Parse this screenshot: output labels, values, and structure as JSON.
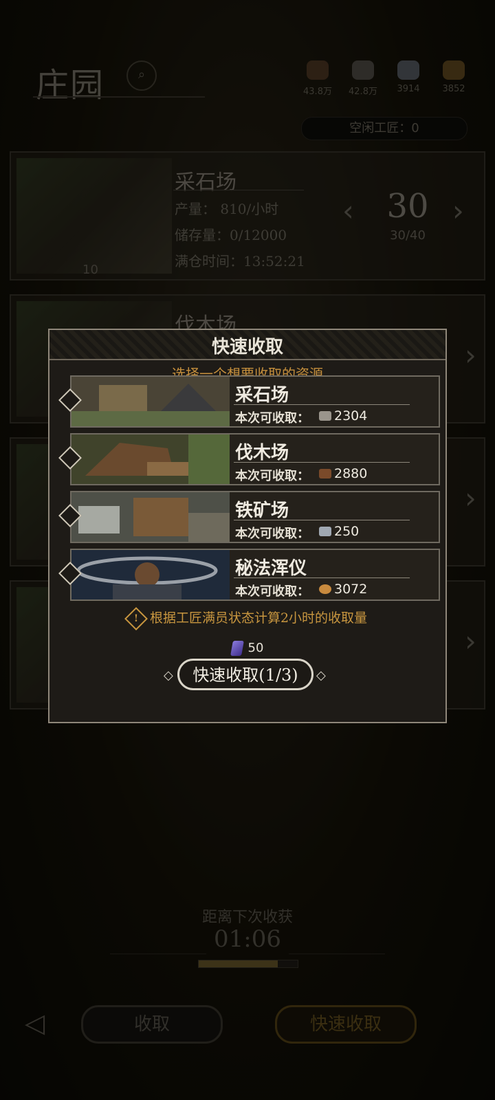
{
  "header": {
    "title": "庄园",
    "resources": [
      {
        "icon": "wood-resource-icon",
        "value": "43.8万",
        "color": "#6b4a30"
      },
      {
        "icon": "stone-resource-icon",
        "value": "42.8万",
        "color": "#6e6a64"
      },
      {
        "icon": "iron-resource-icon",
        "value": "3914",
        "color": "#7a8492"
      },
      {
        "icon": "gold-resource-icon",
        "value": "3852",
        "color": "#8a6a2c"
      }
    ],
    "idle_workers": "空闲工匠：0"
  },
  "cards": [
    {
      "title": "采石场",
      "production": "产量：  810/小时",
      "storage": "储存量：0/12000",
      "full_time": "满仓时间：13:52:21",
      "level": "10",
      "workers": "30",
      "workers_cap": "30/40"
    },
    {
      "title": "伐木场"
    }
  ],
  "modal": {
    "title": "快速收取",
    "subtitle": "选择一个想要收取的资源",
    "collect_label": "本次可收取：",
    "options": [
      {
        "name": "采石场",
        "amount": "2304",
        "icon": "stone-icon",
        "color": "#9a958c"
      },
      {
        "name": "伐木场",
        "amount": "2880",
        "icon": "wood-icon",
        "color": "#7a4a2a"
      },
      {
        "name": "铁矿场",
        "amount": "250",
        "icon": "iron-icon",
        "color": "#a0a8b2"
      },
      {
        "name": "秘法浑仪",
        "amount": "3072",
        "icon": "arcane-icon",
        "color": "#c88a3e"
      }
    ],
    "note": "根据工匠满员状态计算2小时的收取量",
    "cost": "50",
    "button": "快速收取(1/3)"
  },
  "bottom": {
    "next_harvest_label": "距离下次收获",
    "timer": "01:06",
    "progress": 0.8,
    "collect_button": "收取",
    "quick_collect_button": "快速收取"
  },
  "colors": {
    "accent_gold": "#c8963f",
    "modal_border": "#8f877a"
  }
}
